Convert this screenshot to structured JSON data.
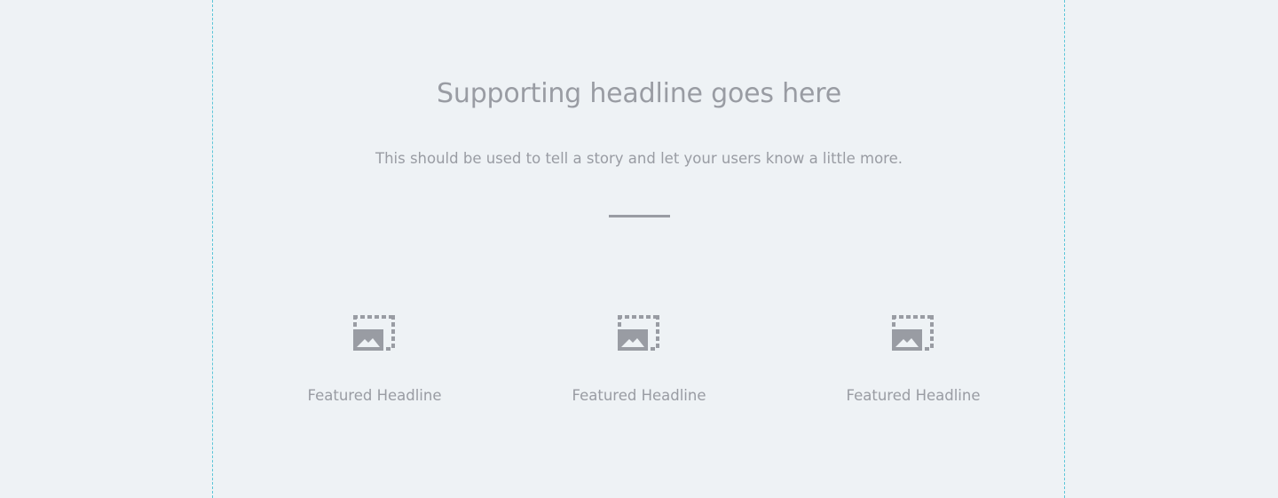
{
  "colors": {
    "background": "#eef2f5",
    "text": "#999ca3",
    "guide": "#5cc6d9"
  },
  "section": {
    "headline": "Supporting headline goes here",
    "subtext": "This should be used to tell a story and let your users know a little more."
  },
  "features": [
    {
      "icon": "image-placeholder-icon",
      "label": "Featured Headline"
    },
    {
      "icon": "image-placeholder-icon",
      "label": "Featured Headline"
    },
    {
      "icon": "image-placeholder-icon",
      "label": "Featured Headline"
    }
  ]
}
